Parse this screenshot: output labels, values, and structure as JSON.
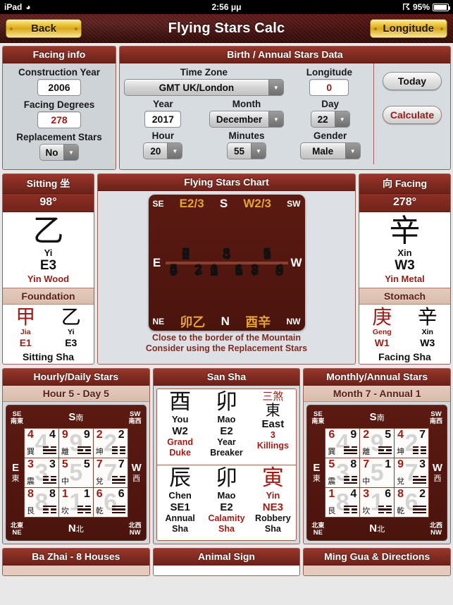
{
  "status_bar": {
    "device": "iPad",
    "wifi_icon": "wifi-icon",
    "time": "2:56 μμ",
    "bluetooth_icon": "bluetooth-icon",
    "battery_percent": "95%"
  },
  "nav": {
    "back_label": "Back",
    "title": "Flying Stars Calc",
    "longitude_label": "Longitude"
  },
  "facing_info": {
    "header": "Facing info",
    "construction_year_label": "Construction Year",
    "construction_year_value": "2006",
    "facing_degrees_label": "Facing Degrees",
    "facing_degrees_value": "278",
    "replacement_stars_label": "Replacement Stars",
    "replacement_stars_value": "No"
  },
  "birth_data": {
    "header": "Birth / Annual Stars Data",
    "time_zone_label": "Time Zone",
    "time_zone_value": "GMT UK/London",
    "longitude_label": "Longitude",
    "longitude_value": "0",
    "year_label": "Year",
    "year_value": "2017",
    "month_label": "Month",
    "month_value": "December",
    "day_label": "Day",
    "day_value": "22",
    "hour_label": "Hour",
    "hour_value": "20",
    "minutes_label": "Minutes",
    "minutes_value": "55",
    "gender_label": "Gender",
    "gender_value": "Male",
    "today_button": "Today",
    "calculate_button": "Calculate"
  },
  "sitting": {
    "header": "Sitting 坐",
    "degrees": "98°",
    "han": "乙",
    "pinyin": "Yi",
    "code": "E3",
    "element": "Yin Wood",
    "foundation_header": "Foundation",
    "foundation": [
      {
        "han": "甲",
        "pinyin": "Jia",
        "code": "E1",
        "red": true
      },
      {
        "han": "乙",
        "pinyin": "Yi",
        "code": "E3",
        "red": false
      }
    ],
    "sha_label": "Sitting Sha"
  },
  "facing": {
    "header": "向 Facing",
    "degrees": "278°",
    "han": "辛",
    "pinyin": "Xin",
    "code": "W3",
    "element": "Yin Metal",
    "foundation_header": "Stomach",
    "foundation": [
      {
        "han": "庚",
        "pinyin": "Geng",
        "code": "W1",
        "red": true
      },
      {
        "han": "辛",
        "pinyin": "Xin",
        "code": "W3",
        "red": false
      }
    ],
    "sha_label": "Facing Sha"
  },
  "flying_stars_chart": {
    "header": "Flying Stars Chart",
    "corner_ne": "NE",
    "corner_nw": "NW",
    "corner_se": "SE",
    "corner_sw": "SW",
    "top_left_gold": "E2/3",
    "top_center": "S",
    "top_right_gold": "W2/3",
    "bottom_left_gold": "卯乙",
    "bottom_center": "N",
    "bottom_right_gold": "酉辛",
    "left_label": "E",
    "right_label": "W",
    "cells": [
      {
        "mountain": "5",
        "water": "2",
        "base": "7",
        "highlight": false
      },
      {
        "mountain": "1",
        "water": "6",
        "base": "3",
        "highlight": false
      },
      {
        "mountain": "3",
        "water": "4",
        "base": "5",
        "highlight": false
      },
      {
        "mountain": "4",
        "water": "3",
        "base": "6",
        "highlight": true
      },
      {
        "mountain": "6",
        "water": "1",
        "base": "8",
        "highlight": false
      },
      {
        "mountain": "8",
        "water": "8",
        "base": "1",
        "highlight": false
      },
      {
        "mountain": "9",
        "water": "7",
        "base": "2",
        "highlight": false
      },
      {
        "mountain": "2",
        "water": "5",
        "base": "4",
        "highlight": false
      },
      {
        "mountain": "7",
        "water": "9",
        "base": "9",
        "highlight": false
      }
    ],
    "note_line1": "Close to the border of the Mountain",
    "note_line2": "Consider using the Replacement Stars"
  },
  "hourly_daily": {
    "header": "Hourly/Daily Stars",
    "subheader": "Hour 5 - Day 5",
    "top_center": "S",
    "top_center_han": "南",
    "bottom_center": "N",
    "bottom_center_han": "北",
    "left": "E",
    "left_han": "東",
    "right": "W",
    "right_han": "西",
    "corner_se": "SE",
    "corner_se_han": "南東",
    "corner_sw": "SW",
    "corner_sw_han": "南西",
    "corner_ne": "NE",
    "corner_ne_han": "北東",
    "corner_nw": "NW",
    "corner_nw_han": "北西",
    "cells": [
      {
        "hour": "4",
        "day": "4",
        "watermark": "4",
        "trigram": "巽",
        "lines": [
          1,
          0,
          1,
          1,
          1,
          1
        ]
      },
      {
        "hour": "9",
        "day": "9",
        "watermark": "9",
        "trigram": "離",
        "lines": [
          1,
          1,
          1,
          0,
          1,
          1
        ]
      },
      {
        "hour": "2",
        "day": "2",
        "watermark": "2",
        "trigram": "坤",
        "lines": [
          1,
          0,
          1,
          0,
          1,
          0
        ]
      },
      {
        "hour": "3",
        "day": "3",
        "watermark": "3",
        "trigram": "震",
        "lines": [
          1,
          0,
          1,
          0,
          1,
          1
        ]
      },
      {
        "hour": "5",
        "day": "5",
        "watermark": "5",
        "trigram": "中",
        "lines": []
      },
      {
        "hour": "7",
        "day": "7",
        "watermark": "7",
        "trigram": "兌",
        "lines": [
          1,
          0,
          1,
          1,
          1,
          1
        ]
      },
      {
        "hour": "8",
        "day": "8",
        "watermark": "8",
        "trigram": "艮",
        "lines": [
          1,
          1,
          1,
          0,
          1,
          0
        ]
      },
      {
        "hour": "1",
        "day": "1",
        "watermark": "1",
        "trigram": "坎",
        "lines": [
          1,
          0,
          1,
          1,
          1,
          0
        ]
      },
      {
        "hour": "6",
        "day": "6",
        "watermark": "6",
        "trigram": "乾",
        "lines": [
          1,
          1,
          1,
          1,
          1,
          1
        ]
      }
    ]
  },
  "san_sha": {
    "header": "San Sha",
    "top_right_han": "三煞",
    "row1": [
      {
        "han": "酉",
        "pinyin": "You",
        "code": "W2",
        "d1": "Grand",
        "d2": "Duke",
        "han_red": false,
        "pinyin_red": false,
        "code_red": false,
        "desc_red": true
      },
      {
        "han": "卯",
        "pinyin": "Mao",
        "code": "E2",
        "d1": "Year",
        "d2": "Breaker",
        "han_red": false,
        "pinyin_red": false,
        "code_red": false,
        "desc_red": false
      },
      {
        "han": "東",
        "pinyin": "East",
        "code": "3",
        "d1": "3",
        "d2": "Killings",
        "han_red": false,
        "pinyin_red": false,
        "code_red": false,
        "desc_red": true
      }
    ],
    "row2": [
      {
        "han": "辰",
        "pinyin": "Chen",
        "code": "SE1",
        "d1": "Annual",
        "d2": "Sha",
        "han_red": false,
        "pinyin_red": false,
        "code_red": false,
        "desc_red": false
      },
      {
        "han": "卯",
        "pinyin": "Mao",
        "code": "E2",
        "d1": "Calamity",
        "d2": "Sha",
        "han_red": false,
        "pinyin_red": false,
        "code_red": false,
        "desc_red": true
      },
      {
        "han": "寅",
        "pinyin": "Yin",
        "code": "NE3",
        "d1": "Robbery",
        "d2": "Sha",
        "han_red": true,
        "pinyin_red": true,
        "code_red": true,
        "desc_red": false
      }
    ]
  },
  "monthly_annual": {
    "header": "Monthly/Annual Stars",
    "subheader": "Month 7 - Annual 1",
    "top_center": "S",
    "top_center_han": "南",
    "bottom_center": "N",
    "bottom_center_han": "北",
    "left": "E",
    "left_han": "東",
    "right": "W",
    "right_han": "西",
    "corner_se": "SE",
    "corner_se_han": "南東",
    "corner_sw": "SW",
    "corner_sw_han": "南西",
    "corner_ne": "NE",
    "corner_ne_han": "北東",
    "corner_nw": "NW",
    "corner_nw_han": "北西",
    "cells": [
      {
        "month": "6",
        "annual": "9",
        "watermark": "4",
        "trigram": "巽",
        "lines": [
          1,
          0,
          1,
          1,
          1,
          1
        ]
      },
      {
        "month": "2",
        "annual": "5",
        "watermark": "9",
        "trigram": "離",
        "lines": [
          1,
          1,
          1,
          0,
          1,
          1
        ]
      },
      {
        "month": "4",
        "annual": "7",
        "watermark": "2",
        "trigram": "坤",
        "lines": [
          1,
          0,
          1,
          0,
          1,
          0
        ]
      },
      {
        "month": "5",
        "annual": "8",
        "watermark": "3",
        "trigram": "震",
        "lines": [
          1,
          0,
          1,
          0,
          1,
          1
        ]
      },
      {
        "month": "7",
        "annual": "1",
        "watermark": "5",
        "trigram": "中",
        "lines": []
      },
      {
        "month": "9",
        "annual": "3",
        "watermark": "7",
        "trigram": "兌",
        "lines": [
          1,
          0,
          1,
          1,
          1,
          1
        ]
      },
      {
        "month": "1",
        "annual": "4",
        "watermark": "8",
        "trigram": "艮",
        "lines": [
          1,
          1,
          1,
          0,
          1,
          0
        ]
      },
      {
        "month": "3",
        "annual": "6",
        "watermark": "1",
        "trigram": "坎",
        "lines": [
          1,
          0,
          1,
          1,
          1,
          0
        ]
      },
      {
        "month": "8",
        "annual": "2",
        "watermark": "6",
        "trigram": "乾",
        "lines": [
          1,
          1,
          1,
          1,
          1,
          1
        ]
      }
    ]
  },
  "bottom_panels": {
    "ba_zhai": "Ba Zhai - 8 Houses",
    "animal_sign": "Animal Sign",
    "ming_gua": "Ming Gua & Directions"
  },
  "colors": {
    "brand_red": "#7e2b21",
    "accent_red": "#9c1c14",
    "gold": "#e3a23a",
    "panel_bg": "#d3d8dc"
  }
}
